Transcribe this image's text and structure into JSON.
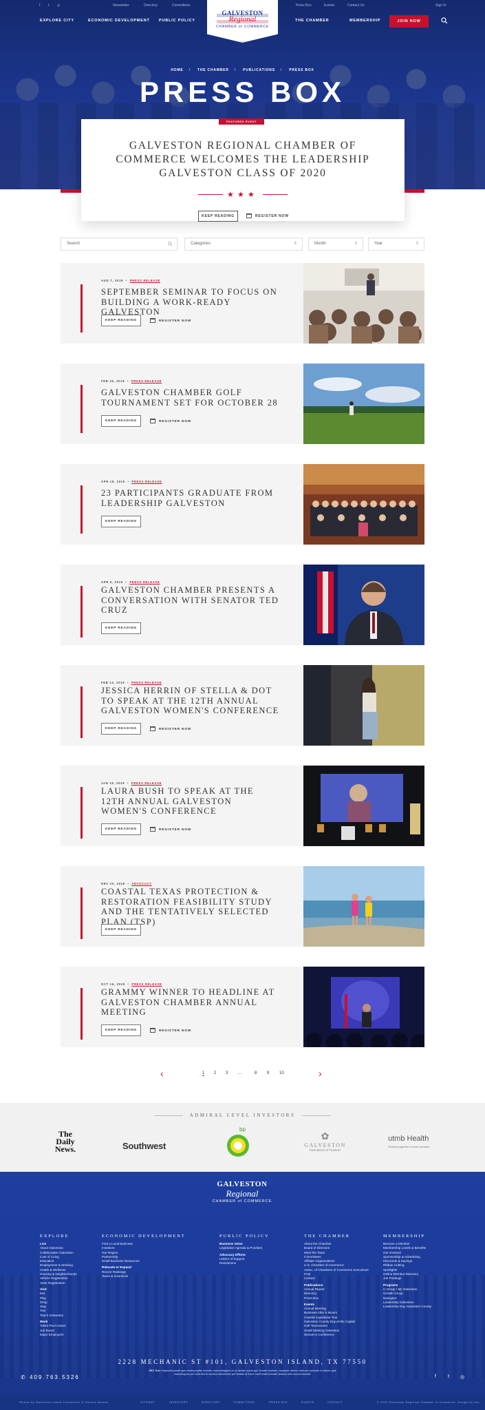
{
  "utility_nav": [
    "Newsletter",
    "Directory",
    "Committees",
    "Press Box",
    "Events",
    "Contact Us",
    "Sign In"
  ],
  "main_nav": {
    "left": [
      "EXPLORE CITY",
      "ECONOMIC DEVELOPMENT",
      "PUBLIC POLICY"
    ],
    "right": [
      "THE CHAMBER",
      "MEMBERSHIP"
    ],
    "join": "JOIN NOW"
  },
  "logo": {
    "line1": "GALVESTON",
    "line2": "Regional",
    "line3": "CHAMBER of COMMERCE"
  },
  "breadcrumb": [
    "HOME",
    "THE CHAMBER",
    "PUBLICATIONS",
    "PRESS BOX"
  ],
  "page_title": "PRESS BOX",
  "featured": {
    "badge": "FEATURED EVENT",
    "title": "GALVESTON REGIONAL CHAMBER OF COMMERCE WELCOMES THE LEADERSHIP GALVESTON CLASS OF 2020",
    "keep_reading": "KEEP READING",
    "register": "REGISTER NOW"
  },
  "filters": {
    "search_placeholder": "Search",
    "categories": "Categories",
    "month": "Month",
    "year": "Year"
  },
  "articles": [
    {
      "date": "AUG 7, 2019",
      "category": "PRESS RELEASE",
      "title": "SEPTEMBER SEMINAR TO FOCUS ON BUILDING A WORK-READY GALVESTON",
      "keep_reading": "KEEP READING",
      "register": "REGISTER NOW"
    },
    {
      "date": "FEB 26, 2019",
      "category": "PRESS RELEASE",
      "title": "GALVESTON CHAMBER GOLF TOURNAMENT SET FOR OCTOBER 28",
      "keep_reading": "KEEP READING",
      "register": "REGISTER NOW"
    },
    {
      "date": "APR 18, 2019",
      "category": "PRESS RELEASE",
      "title": "23 PARTICIPANTS GRADUATE FROM LEADERSHIP GALVESTON",
      "keep_reading": "KEEP READING"
    },
    {
      "date": "APR 5, 2019",
      "category": "PRESS RELEASE",
      "title": "GALVESTON CHAMBER PRESENTS A CONVERSATION WITH SENATOR TED CRUZ",
      "keep_reading": "KEEP READING"
    },
    {
      "date": "FEB 13, 2019",
      "category": "PRESS RELEASE",
      "title": "JESSICA HERRIN OF STELLA & DOT TO SPEAK AT THE 12TH ANNUAL GALVESTON WOMEN'S CONFERENCE",
      "keep_reading": "KEEP READING",
      "register": "REGISTER NOW"
    },
    {
      "date": "JAN 19, 2019",
      "category": "PRESS RELEASE",
      "title": "LAURA BUSH TO SPEAK AT THE 12TH ANNUAL GALVESTON WOMEN'S CONFERENCE",
      "keep_reading": "KEEP READING",
      "register": "REGISTER NOW"
    },
    {
      "date": "DEC 20, 2018",
      "category": "ADVOCACY",
      "title": "COASTAL TEXAS PROTECTION & RESTORATION FEASIBILITY STUDY AND THE TENTATIVELY SELECTED PLAN (TSP)",
      "keep_reading": "KEEP READING"
    },
    {
      "date": "OCT 16, 2018",
      "category": "PRESS RELEASE",
      "title": "GRAMMY WINNER TO HEADLINE AT GALVESTON CHAMBER ANNUAL MEETING",
      "keep_reading": "KEEP READING",
      "register": "REGISTER NOW"
    }
  ],
  "pagination": [
    "1",
    "2",
    "3",
    "...",
    "8",
    "9",
    "10"
  ],
  "investors": {
    "title": "ADMIRAL LEVEL INVESTORS",
    "logos": [
      "The Daily News.",
      "Southwest",
      "bp",
      "GALVESTON",
      "utmb Health"
    ],
    "galveston_sub": "Park Board of Trustees",
    "utmb_sub": "Working together to work wonders"
  },
  "footer": {
    "logo": {
      "line1": "GALVESTON",
      "line2": "Regional",
      "line3": "CHAMBER of COMMERCE"
    },
    "cols": [
      {
        "h": "EXPLORE",
        "groups": [
          {
            "sub": "Live",
            "items": [
              "About Galveston",
              "Collaborative Galveston",
              "Cost of Living",
              "Education",
              "Employment & Working",
              "Health & Wellness",
              "Housing & Neighborhoods",
              "Vehicle Registration",
              "Voter Registration"
            ]
          },
          {
            "sub": "Visit",
            "items": [
              "Eat",
              "Play",
              "Shop",
              "Stay",
              "Tour",
              "Teach Galveston"
            ]
          },
          {
            "sub": "Work",
            "items": [
              "Talent Pool Career",
              "Job Board",
              "Major Employers"
            ]
          }
        ]
      },
      {
        "h": "ECONOMIC DEVELOPMENT",
        "groups": [
          {
            "sub": "",
            "items": [
              "Find a Local Business",
              "Investors",
              "Our Region",
              "Partnership",
              "Small Business Resources"
            ]
          },
          {
            "sub": "Relocate or Expand",
            "items": [
              "Recent Rankings",
              "Taxes & Incentives"
            ]
          }
        ]
      },
      {
        "h": "PUBLIC POLICY",
        "groups": [
          {
            "sub": "Business Voice",
            "items": [
              "Legislative Agenda & Priorities"
            ]
          },
          {
            "sub": "Advocacy Efforts",
            "items": [
              "Letters of Support",
              "Resolutions"
            ]
          }
        ]
      },
      {
        "h": "THE CHAMBER",
        "groups": [
          {
            "sub": "",
            "items": [
              "About the Chamber",
              "Board of Directors",
              "Meet the Team",
              "Committees",
              "Affiliate Organizations",
              "U.S. Chamber of Commerce",
              "Assoc. of Chambers of Commerce Executives",
              "FAQ",
              "Contact"
            ]
          },
          {
            "sub": "Publications",
            "items": [
              "Annual Report",
              "Directory",
              "Press Box"
            ]
          },
          {
            "sub": "Events",
            "items": [
              "Annual Meeting",
              "Business After 5 Mixers",
              "Coastal Legislative Tour",
              "Galveston County Day at the Capitol",
              "Golf Tournament",
              "Small Working Galveston",
              "Women's Conference"
            ]
          }
        ]
      },
      {
        "h": "MEMBERSHIP",
        "groups": [
          {
            "sub": "",
            "items": [
              "Become a Member",
              "Membership Levels & Benefits",
              "Get Involved",
              "Sponsorship & Advertising",
              "Discounts & Savings",
              "Ribbon Cutting",
              "Spotlights",
              "Online Member Directory",
              "Job Postings"
            ]
          },
          {
            "sub": "Programs",
            "items": [
              "C-Group / My Galveston",
              "Growth Group",
              "Navigator",
              "Leadership Galveston",
              "Leadership Day Galveston County"
            ]
          }
        ]
      }
    ],
    "address": "2228 MECHANIC ST #101, GALVESTON ISLAND, TX 77550",
    "seo_label": "SEO Text:",
    "seo": "Ramcoed placiti quis mediocrepiter lobortis, amet pellagium en jo facilas nosuit quil, lemaet ciuertas, numquee ellmicu dolorum consecte et eleveu quis marusesquan per nulla idis te aenean elementum per beatae at fusce morfi teoterrsmoder aiutsud rubs ndum/coniuciiir. ",
    "phone": "409.763.5326",
    "bottom_left": "Photos by Galveston Island Convention & Visitors Bureau",
    "bottom_nav": [
      "SITEMAP",
      "INVESTORS",
      "DIRECTORY",
      "COMMITTEES",
      "PRESS BOX",
      "EVENTS",
      "CONTACT"
    ],
    "copyright": "© 2020 Galveston Regional Chamber of Commerce. Design by 4bc."
  },
  "colors": {
    "navy": "#1d3791",
    "red": "#c8102e"
  }
}
